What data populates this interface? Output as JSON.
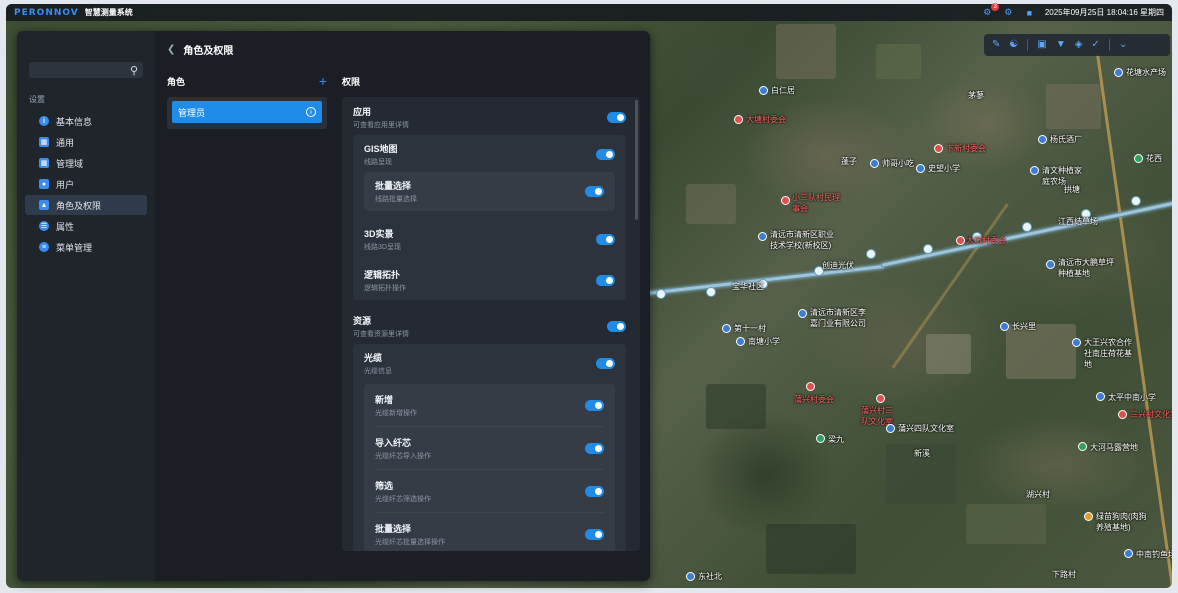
{
  "topbar": {
    "logo": "PERONNOV",
    "system_title": "智慧测量系统",
    "notification_count": "3",
    "datetime": "2025年09月25日 18:04:16 星期四"
  },
  "map": {
    "labels": [
      {
        "text": "花塘水产场"
      },
      {
        "text": "白仁居"
      },
      {
        "text": "茅蓼"
      },
      {
        "text": "大塘村委会",
        "red": true
      },
      {
        "text": "杨氏酒厂"
      },
      {
        "text": "下新村委会",
        "red": true
      },
      {
        "text": "花西"
      },
      {
        "text": "清文种植家庭农场"
      },
      {
        "text": "拱塘"
      },
      {
        "text": "蓬子"
      },
      {
        "text": "帅哥小吃"
      },
      {
        "text": "史望小学"
      },
      {
        "text": "小三队村民理事会",
        "red": true
      },
      {
        "text": "江西结草场"
      },
      {
        "text": "清远市清新区职业技术学校(新校区)"
      },
      {
        "text": "大坑村委会",
        "red": true
      },
      {
        "text": "创迪光伏"
      },
      {
        "text": "清远市大鹏草坪种植基地"
      },
      {
        "text": "宝华社区"
      },
      {
        "text": "清远市清新区李嘉门业有限公司"
      },
      {
        "text": "第十一村"
      },
      {
        "text": "长兴里"
      },
      {
        "text": "南塘小学"
      },
      {
        "text": "大王兴农合作社南庄荷花基地"
      },
      {
        "text": "蒲兴村委会",
        "red": true
      },
      {
        "text": "太平中南小学"
      },
      {
        "text": "蒲兴村三队文化室",
        "red": true
      },
      {
        "text": "三兴村文化室",
        "red": true
      },
      {
        "text": "蒲兴四队文化室"
      },
      {
        "text": "梁九"
      },
      {
        "text": "大河马露营地"
      },
      {
        "text": "新溪"
      },
      {
        "text": "湖兴村"
      },
      {
        "text": "绿苗狗肉(肉狗养殖基地)"
      },
      {
        "text": "中南钓鱼场"
      },
      {
        "text": "东社北"
      },
      {
        "text": "下路村"
      }
    ]
  },
  "map_toolbar": {
    "icons": [
      "pencil-icon",
      "person-icon",
      "layer-icon",
      "filter-icon",
      "stack-icon",
      "ruler-icon",
      "chevron-down-icon"
    ]
  },
  "sidebar": {
    "search_placeholder": "",
    "section_label": "设置",
    "items": [
      {
        "label": "基本信息",
        "icon": "info-icon",
        "active": false
      },
      {
        "label": "通用",
        "icon": "grid-icon",
        "active": false
      },
      {
        "label": "管理域",
        "icon": "domain-icon",
        "active": false
      },
      {
        "label": "用户",
        "icon": "user-icon",
        "active": false
      },
      {
        "label": "角色及权限",
        "icon": "shield-icon",
        "active": true
      },
      {
        "label": "属性",
        "icon": "attribute-icon",
        "active": false
      },
      {
        "label": "菜单管理",
        "icon": "menu-icon",
        "active": false
      }
    ]
  },
  "content": {
    "title": "角色及权限",
    "roles": {
      "heading": "角色",
      "items": [
        {
          "label": "管理员",
          "selected": true
        }
      ]
    },
    "permissions": {
      "heading": "权限",
      "groups": [
        {
          "title": "应用",
          "subtitle": "可查看应用里详情",
          "enabled": true,
          "children": [
            {
              "title": "GIS地图",
              "subtitle": "线路呈现",
              "enabled": true,
              "children": [
                {
                  "title": "批量选择",
                  "subtitle": "线路批量选择",
                  "enabled": true
                }
              ]
            },
            {
              "title": "3D实景",
              "subtitle": "线路3D呈现",
              "enabled": true
            },
            {
              "title": "逻辑拓扑",
              "subtitle": "逻辑拓扑操作",
              "enabled": true
            }
          ]
        },
        {
          "title": "资源",
          "subtitle": "可查看资源里详情",
          "enabled": true,
          "children": [
            {
              "title": "光缆",
              "subtitle": "光缆信息",
              "enabled": true,
              "children": [
                {
                  "title": "新增",
                  "subtitle": "光缆新增操作",
                  "enabled": true
                },
                {
                  "title": "导入纤芯",
                  "subtitle": "光缆纤芯导入操作",
                  "enabled": true
                },
                {
                  "title": "筛选",
                  "subtitle": "光缆纤芯筛选操作",
                  "enabled": true
                },
                {
                  "title": "批量选择",
                  "subtitle": "光缆纤芯批量选择操作",
                  "enabled": true
                }
              ]
            }
          ]
        }
      ]
    }
  }
}
